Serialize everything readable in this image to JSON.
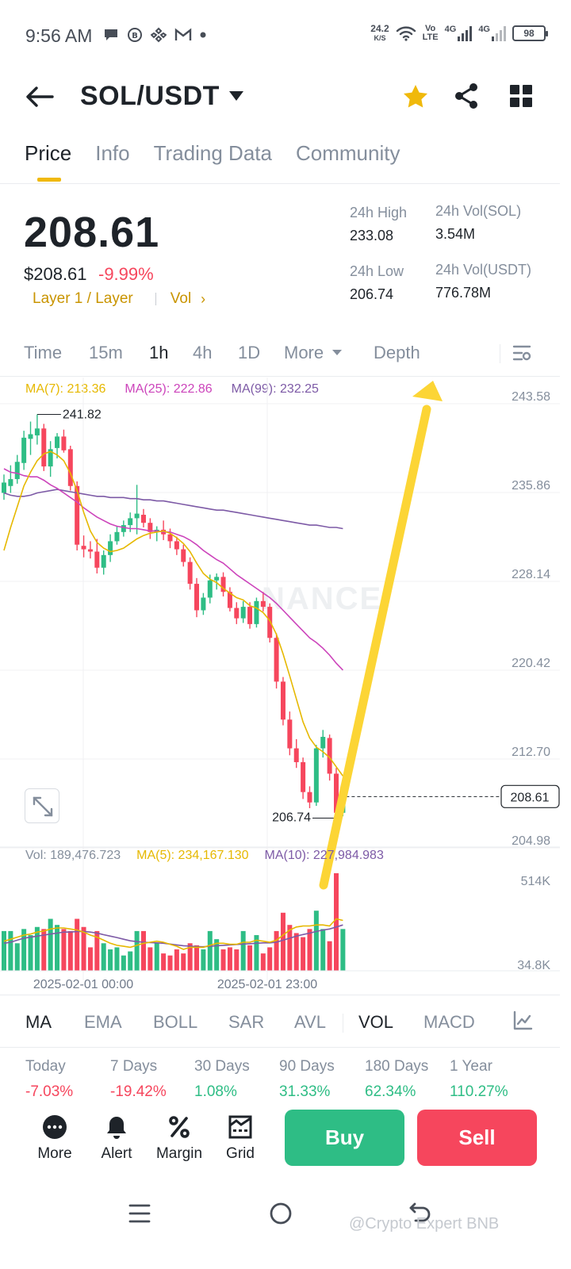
{
  "status_bar": {
    "time": "9:56 AM",
    "net_speed_value": "24.2",
    "net_speed_unit": "K/S",
    "volte_top": "Vo",
    "volte_bottom": "LTE",
    "net1": "4G",
    "net2": "4G",
    "battery": "98"
  },
  "header": {
    "pair": "SOL/USDT"
  },
  "tabs": [
    "Price",
    "Info",
    "Trading Data",
    "Community"
  ],
  "price": {
    "last": "208.61",
    "usd": "$208.61",
    "change": "-9.99%",
    "tag": "Layer 1 / Layer",
    "vol_link": "Vol",
    "chevron": "›"
  },
  "stats": {
    "high_label": "24h High",
    "high_value": "233.08",
    "low_label": "24h Low",
    "low_value": "206.74",
    "vol_sol_label": "24h Vol(SOL)",
    "vol_sol_value": "3.54M",
    "vol_usdt_label": "24h Vol(USDT)",
    "vol_usdt_value": "776.78M"
  },
  "intervals": {
    "time": "Time",
    "m15": "15m",
    "h1": "1h",
    "h4": "4h",
    "d1": "1D",
    "more": "More",
    "depth": "Depth"
  },
  "ma_legend": {
    "ma7": "MA(7): 213.36",
    "ma25": "MA(25): 222.86",
    "ma99": "MA(99): 232.25"
  },
  "vol_legend": {
    "vol": "Vol: 189,476.723",
    "ma5": "MA(5): 234,167.130",
    "ma10": "MA(10): 227,984.983"
  },
  "colors": {
    "up": "#2ebd85",
    "down": "#f6465d",
    "ma7": "#e6b800",
    "ma25": "#cc44bb",
    "ma99": "#7d5aa6",
    "accent": "#f0b90b",
    "arrow": "#fcd535"
  },
  "chart_data": {
    "type": "candlestick",
    "y_ticks": [
      "243.58",
      "235.86",
      "228.14",
      "220.42",
      "212.70",
      "204.98"
    ],
    "ylim": [
      204.98,
      243.58
    ],
    "x_tick_labels": [
      "2025-02-01 00:00",
      "2025-02-01 23:00"
    ],
    "high_marker": "241.82",
    "low_marker": "206.74",
    "last_price_label": "208.61",
    "vol_ticks": [
      "514K",
      "34.8K"
    ],
    "vol_ylim": [
      34.8,
      514
    ],
    "candles": [
      {
        "o": 235.0,
        "h": 236.6,
        "l": 234.4,
        "c": 235.9
      },
      {
        "o": 235.6,
        "h": 237.4,
        "l": 235.0,
        "c": 236.2
      },
      {
        "o": 236.2,
        "h": 238.3,
        "l": 235.8,
        "c": 237.7
      },
      {
        "o": 237.6,
        "h": 240.4,
        "l": 237.0,
        "c": 239.8
      },
      {
        "o": 239.7,
        "h": 241.2,
        "l": 238.3,
        "c": 240.1
      },
      {
        "o": 240.0,
        "h": 241.82,
        "l": 239.2,
        "c": 240.6
      },
      {
        "o": 240.6,
        "h": 241.0,
        "l": 236.9,
        "c": 237.3
      },
      {
        "o": 237.3,
        "h": 239.5,
        "l": 236.4,
        "c": 238.8
      },
      {
        "o": 238.9,
        "h": 240.2,
        "l": 238.0,
        "c": 239.9
      },
      {
        "o": 239.9,
        "h": 240.5,
        "l": 238.5,
        "c": 238.7
      },
      {
        "o": 238.8,
        "h": 239.1,
        "l": 235.2,
        "c": 235.6
      },
      {
        "o": 235.6,
        "h": 236.0,
        "l": 230.0,
        "c": 230.5
      },
      {
        "o": 230.4,
        "h": 231.3,
        "l": 229.4,
        "c": 230.1
      },
      {
        "o": 230.1,
        "h": 230.8,
        "l": 229.3,
        "c": 229.9
      },
      {
        "o": 229.9,
        "h": 231.0,
        "l": 228.0,
        "c": 228.5
      },
      {
        "o": 228.5,
        "h": 230.0,
        "l": 227.9,
        "c": 229.6
      },
      {
        "o": 229.6,
        "h": 231.4,
        "l": 229.0,
        "c": 230.8
      },
      {
        "o": 230.8,
        "h": 232.1,
        "l": 230.5,
        "c": 231.6
      },
      {
        "o": 231.6,
        "h": 232.6,
        "l": 231.2,
        "c": 232.2
      },
      {
        "o": 232.2,
        "h": 233.3,
        "l": 231.6,
        "c": 232.8
      },
      {
        "o": 232.8,
        "h": 235.7,
        "l": 231.4,
        "c": 233.2
      },
      {
        "o": 233.1,
        "h": 233.6,
        "l": 232.0,
        "c": 232.4
      },
      {
        "o": 232.4,
        "h": 232.8,
        "l": 231.0,
        "c": 231.6
      },
      {
        "o": 231.6,
        "h": 232.1,
        "l": 230.8,
        "c": 231.8
      },
      {
        "o": 231.8,
        "h": 232.6,
        "l": 230.9,
        "c": 231.4
      },
      {
        "o": 231.4,
        "h": 231.9,
        "l": 230.2,
        "c": 230.8
      },
      {
        "o": 230.8,
        "h": 231.2,
        "l": 229.6,
        "c": 230.1
      },
      {
        "o": 230.1,
        "h": 230.5,
        "l": 228.6,
        "c": 229.0
      },
      {
        "o": 229.0,
        "h": 229.4,
        "l": 226.6,
        "c": 227.1
      },
      {
        "o": 227.1,
        "h": 227.6,
        "l": 224.2,
        "c": 224.8
      },
      {
        "o": 224.8,
        "h": 226.3,
        "l": 224.4,
        "c": 225.9
      },
      {
        "o": 225.9,
        "h": 227.9,
        "l": 225.4,
        "c": 227.4
      },
      {
        "o": 227.4,
        "h": 228.0,
        "l": 226.6,
        "c": 227.7
      },
      {
        "o": 227.7,
        "h": 228.1,
        "l": 226.0,
        "c": 226.4
      },
      {
        "o": 226.4,
        "h": 226.8,
        "l": 224.7,
        "c": 225.0
      },
      {
        "o": 225.0,
        "h": 225.5,
        "l": 223.6,
        "c": 224.1
      },
      {
        "o": 224.1,
        "h": 225.6,
        "l": 223.7,
        "c": 225.1
      },
      {
        "o": 225.1,
        "h": 225.5,
        "l": 223.2,
        "c": 223.6
      },
      {
        "o": 223.6,
        "h": 225.9,
        "l": 223.3,
        "c": 225.6
      },
      {
        "o": 225.6,
        "h": 226.4,
        "l": 224.7,
        "c": 225.1
      },
      {
        "o": 225.1,
        "h": 225.4,
        "l": 222.0,
        "c": 222.4
      },
      {
        "o": 222.4,
        "h": 222.8,
        "l": 218.0,
        "c": 218.6
      },
      {
        "o": 218.6,
        "h": 219.0,
        "l": 214.8,
        "c": 215.3
      },
      {
        "o": 215.3,
        "h": 216.0,
        "l": 212.2,
        "c": 212.8
      },
      {
        "o": 212.8,
        "h": 213.6,
        "l": 211.1,
        "c": 211.6
      },
      {
        "o": 211.6,
        "h": 212.0,
        "l": 208.4,
        "c": 209.0
      },
      {
        "o": 209.0,
        "h": 209.5,
        "l": 207.6,
        "c": 208.1
      },
      {
        "o": 208.1,
        "h": 213.1,
        "l": 207.8,
        "c": 212.8
      },
      {
        "o": 212.8,
        "h": 214.4,
        "l": 212.0,
        "c": 213.8
      },
      {
        "o": 213.7,
        "h": 214.0,
        "l": 210.0,
        "c": 210.6
      },
      {
        "o": 210.6,
        "h": 211.1,
        "l": 206.74,
        "c": 207.2
      },
      {
        "o": 207.2,
        "h": 208.9,
        "l": 206.9,
        "c": 208.61
      }
    ],
    "ma7": [
      230.0,
      232.0,
      233.8,
      235.6,
      236.8,
      237.8,
      238.4,
      238.6,
      238.3,
      237.8,
      236.7,
      235.2,
      233.3,
      231.7,
      230.7,
      230.2,
      229.9,
      230.0,
      230.2,
      230.6,
      231.0,
      231.3,
      231.5,
      231.6,
      231.7,
      231.5,
      231.1,
      230.6,
      229.9,
      228.9,
      228.0,
      227.5,
      227.2,
      226.7,
      226.3,
      225.9,
      225.7,
      225.2,
      225.0,
      224.6,
      223.9,
      222.7,
      221.0,
      219.1,
      217.1,
      215.1,
      213.7,
      212.9,
      212.5,
      212.0,
      211.2,
      210.4
    ],
    "ma25": [
      237.1,
      236.8,
      236.7,
      236.5,
      236.4,
      236.4,
      236.1,
      235.7,
      235.4,
      235.0,
      234.6,
      234.2,
      233.7,
      233.3,
      232.9,
      232.6,
      232.3,
      232.1,
      232.0,
      231.9,
      231.9,
      231.8,
      231.7,
      231.7,
      231.6,
      231.6,
      231.4,
      231.2,
      230.9,
      230.5,
      230.0,
      229.6,
      229.2,
      228.9,
      228.4,
      227.9,
      227.5,
      227.1,
      226.7,
      226.3,
      225.9,
      225.4,
      224.8,
      224.2,
      223.6,
      223.0,
      222.4,
      222.0,
      221.5,
      220.9,
      220.2,
      219.6
    ],
    "ma99": [
      235.0,
      234.8,
      234.7,
      234.7,
      234.8,
      235.0,
      235.1,
      235.2,
      235.3,
      235.2,
      235.1,
      235.0,
      234.9,
      234.8,
      234.7,
      234.7,
      234.6,
      234.6,
      234.6,
      234.5,
      234.5,
      234.4,
      234.4,
      234.3,
      234.3,
      234.2,
      234.1,
      234.0,
      233.9,
      233.8,
      233.7,
      233.6,
      233.5,
      233.5,
      233.4,
      233.3,
      233.2,
      233.1,
      233.0,
      232.9,
      232.8,
      232.7,
      232.6,
      232.5,
      232.4,
      232.3,
      232.2,
      232.2,
      232.1,
      232.0,
      232.0,
      231.9
    ],
    "volumes": [
      230,
      230,
      170,
      240,
      210,
      250,
      240,
      290,
      260,
      240,
      230,
      290,
      250,
      150,
      230,
      170,
      140,
      150,
      110,
      130,
      230,
      230,
      150,
      170,
      120,
      110,
      140,
      120,
      170,
      160,
      140,
      230,
      190,
      140,
      150,
      140,
      230,
      160,
      210,
      120,
      150,
      230,
      320,
      260,
      220,
      200,
      240,
      330,
      240,
      180,
      514,
      240
    ],
    "vol_ma5": [
      180,
      190,
      200,
      210,
      215,
      225,
      230,
      240,
      245,
      245,
      240,
      235,
      225,
      210,
      200,
      185,
      170,
      160,
      155,
      150,
      160,
      170,
      175,
      180,
      175,
      165,
      155,
      140,
      150,
      150,
      150,
      160,
      170,
      170,
      165,
      165,
      175,
      175,
      185,
      180,
      175,
      185,
      210,
      235,
      250,
      255,
      255,
      260,
      260,
      255,
      290,
      282
    ],
    "vol_ma10": [
      170,
      175,
      185,
      195,
      200,
      205,
      210,
      215,
      220,
      225,
      225,
      228,
      228,
      225,
      220,
      212,
      205,
      198,
      190,
      182,
      178,
      175,
      173,
      172,
      170,
      166,
      162,
      158,
      156,
      154,
      153,
      155,
      158,
      160,
      162,
      164,
      166,
      168,
      170,
      172,
      172,
      175,
      185,
      195,
      205,
      213,
      220,
      228,
      235,
      240,
      250,
      260
    ]
  },
  "indicators": {
    "ma": "MA",
    "ema": "EMA",
    "boll": "BOLL",
    "sar": "SAR",
    "avl": "AVL",
    "vol": "VOL",
    "macd": "MACD"
  },
  "performance": [
    {
      "label": "Today",
      "value": "-7.03%",
      "dir": "neg"
    },
    {
      "label": "7 Days",
      "value": "-19.42%",
      "dir": "neg"
    },
    {
      "label": "30 Days",
      "value": "1.08%",
      "dir": "pos"
    },
    {
      "label": "90 Days",
      "value": "31.33%",
      "dir": "pos"
    },
    {
      "label": "180 Days",
      "value": "62.34%",
      "dir": "pos"
    },
    {
      "label": "1 Year",
      "value": "110.27%",
      "dir": "pos"
    }
  ],
  "actions": {
    "more": "More",
    "alert": "Alert",
    "margin": "Margin",
    "grid": "Grid",
    "buy": "Buy",
    "sell": "Sell"
  },
  "watermark": "@Crypto Expert BNB",
  "chart_watermark": "NANCE"
}
